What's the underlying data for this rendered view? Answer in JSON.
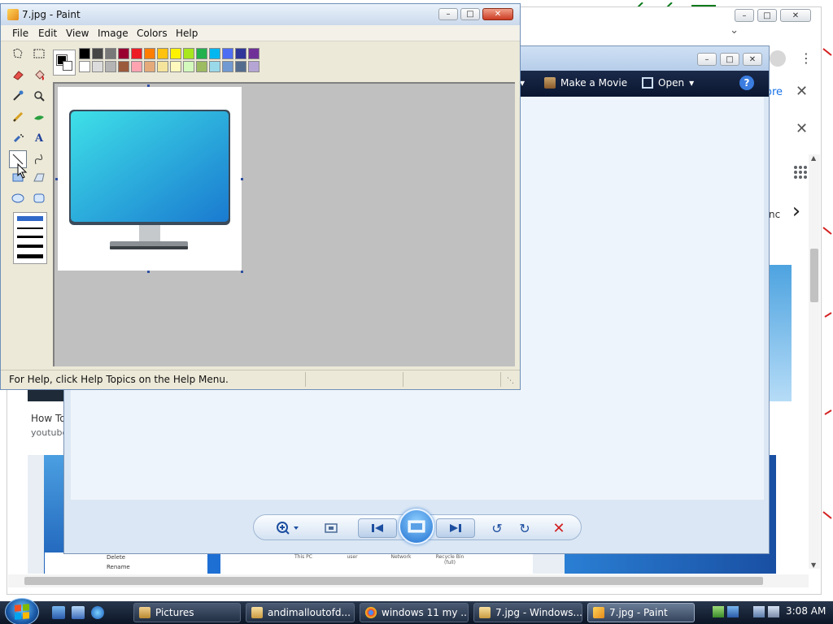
{
  "paint": {
    "title": "7.jpg - Paint",
    "menu": [
      "File",
      "Edit",
      "View",
      "Image",
      "Colors",
      "Help"
    ],
    "status": "For Help, click Help Topics on the Help Menu.",
    "palette_top": [
      "#000000",
      "#464646",
      "#787878",
      "#990030",
      "#ed1c24",
      "#ff7e00",
      "#ffc20e",
      "#fff200",
      "#a8e61d",
      "#22b14c",
      "#00b7ef",
      "#4d6df3",
      "#2f3699",
      "#6f3198"
    ],
    "palette_bottom": [
      "#ffffff",
      "#dcdcdc",
      "#b4b4b4",
      "#9c5a3c",
      "#ffa3b1",
      "#e5aa7a",
      "#f5e49c",
      "#fff9bd",
      "#d3f9bc",
      "#9dbb61",
      "#99d9ea",
      "#709ad1",
      "#546d8e",
      "#b5a5d5"
    ]
  },
  "viewer": {
    "menu_movie": "Make a Movie",
    "menu_open": "Open",
    "help": "?"
  },
  "browser": {
    "more": "ore",
    "snippet": "nc",
    "result_title": "How To",
    "result_source": "youtube",
    "strip_delete": "Delete",
    "strip_rename": "Rename",
    "strip_icons": [
      "This PC",
      "user",
      "Network",
      "Recycle Bin (full)"
    ]
  },
  "taskbar": {
    "buttons": [
      "Pictures",
      "andimalloutofd...",
      "windows 11 my ...",
      "7.jpg - Windows...",
      "7.jpg - Paint"
    ],
    "time": "3:08 AM"
  },
  "colors": {
    "accent": "#1d4fa0",
    "paint_close": "#cc3b22"
  }
}
